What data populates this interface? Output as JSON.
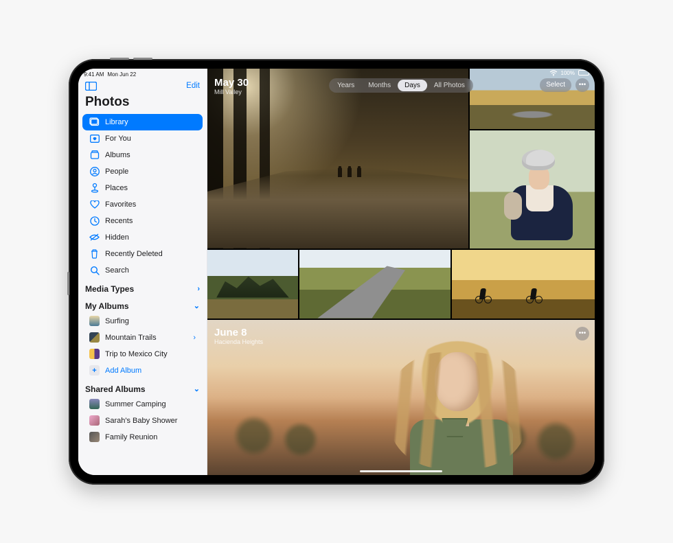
{
  "status": {
    "time": "9:41 AM",
    "date": "Mon Jun 22",
    "battery_pct": "100%"
  },
  "sidebar": {
    "edit_label": "Edit",
    "app_title": "Photos",
    "items": [
      {
        "label": "Library"
      },
      {
        "label": "For You"
      },
      {
        "label": "Albums"
      },
      {
        "label": "People"
      },
      {
        "label": "Places"
      },
      {
        "label": "Favorites"
      },
      {
        "label": "Recents"
      },
      {
        "label": "Hidden"
      },
      {
        "label": "Recently Deleted"
      },
      {
        "label": "Search"
      }
    ],
    "media_types_header": "Media Types",
    "my_albums_header": "My Albums",
    "my_albums": [
      {
        "label": "Surfing"
      },
      {
        "label": "Mountain Trails"
      },
      {
        "label": "Trip to Mexico City"
      }
    ],
    "add_album_label": "Add Album",
    "shared_albums_header": "Shared Albums",
    "shared_albums": [
      {
        "label": "Summer Camping"
      },
      {
        "label": "Sarah's Baby Shower"
      },
      {
        "label": "Family Reunion"
      }
    ]
  },
  "content": {
    "segments": [
      "Years",
      "Months",
      "Days",
      "All Photos"
    ],
    "select_label": "Select",
    "day1": {
      "title": "May 30",
      "subtitle": "Mill Valley"
    },
    "day2": {
      "title": "June 8",
      "subtitle": "Hacienda Heights"
    }
  }
}
